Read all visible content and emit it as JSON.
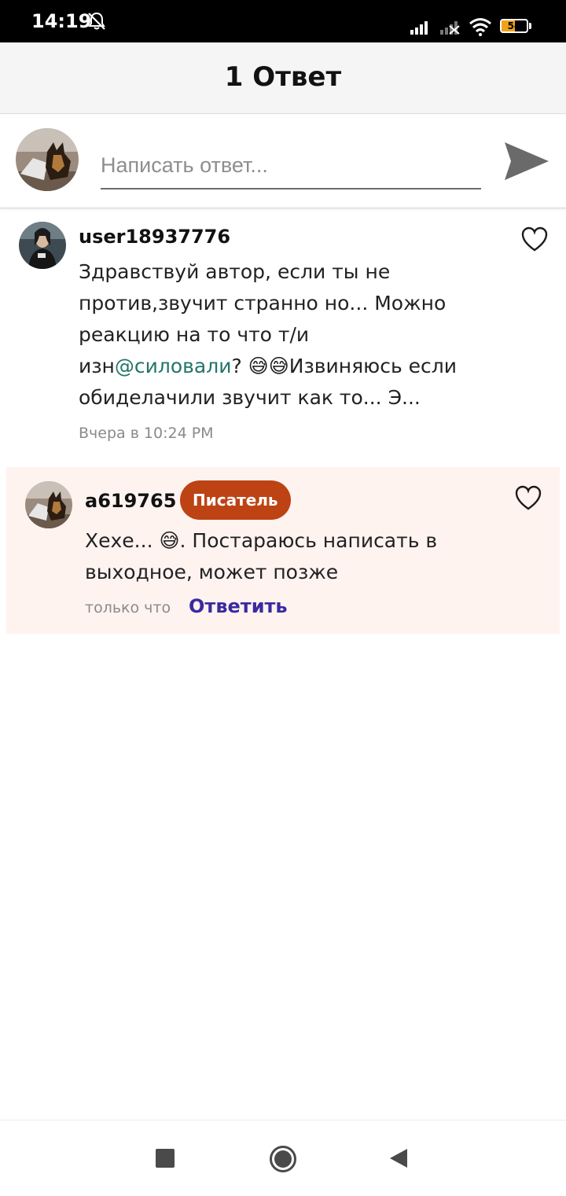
{
  "status_bar": {
    "time": "14:19",
    "battery": "54",
    "battery_level": 0.54
  },
  "header": {
    "title": "1 Ответ"
  },
  "composer": {
    "placeholder": "Написать ответ..."
  },
  "comments": [
    {
      "username": "user18937776",
      "text_before": "Здравствуй автор, если ты не против,звучит странно но... Можно реакцию на то что т/и изн",
      "mention": "@силовали",
      "text_after": "? 😅😅Извиняюсь если обиделачили звучит как то... Э...",
      "time": "Вчера в 10:24 PM"
    }
  ],
  "reply": {
    "username": "a619765",
    "badge": "Писатель",
    "text": "Хехе... 😅. Постараюсь написать в выходное, может позже",
    "time": "только что",
    "reply_label": "Ответить"
  }
}
